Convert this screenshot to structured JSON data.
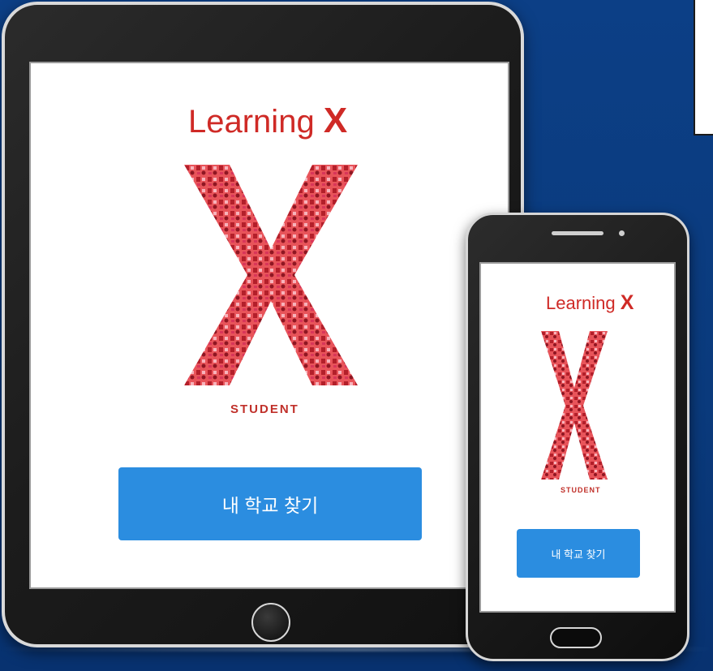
{
  "tablet": {
    "logo": {
      "word": "Learning",
      "letter": "X"
    },
    "tagline": "STUDENT",
    "find_school_button": "내 학교 찾기"
  },
  "phone": {
    "logo": {
      "word": "Learning",
      "letter": "X"
    },
    "tagline": "STUDENT",
    "find_school_button": "내 학교 찾기"
  },
  "colors": {
    "brand_red": "#cf2a26",
    "button_blue": "#2b8de0",
    "background_blue": "#0c3f86",
    "device_frame": "#1c1c1c"
  }
}
